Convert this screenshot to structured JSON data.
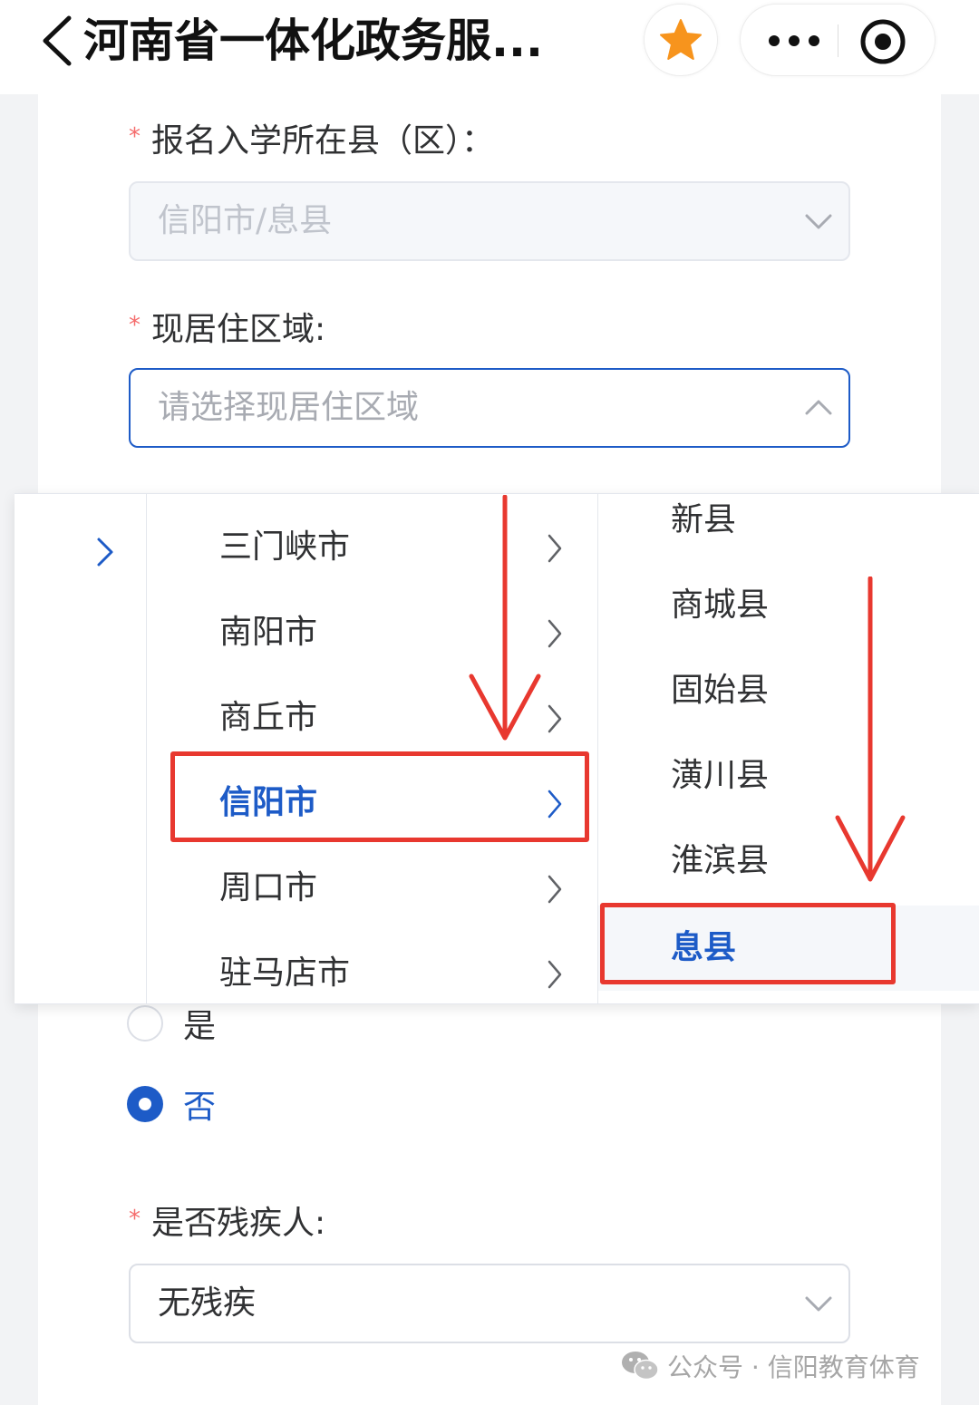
{
  "navbar": {
    "title": "河南省一体化政务服...",
    "icons": {
      "back": "chevron-left-icon",
      "favorite": "star-icon",
      "more": "more-dots-icon",
      "close": "record-circle-icon"
    },
    "star_color": "#f7941d"
  },
  "form": {
    "enroll_county": {
      "label": "报名入学所在县（区）：",
      "value": "信阳市/息县",
      "disabled": true
    },
    "residence_area": {
      "label": "现居住区域:",
      "placeholder": "请选择现居住区域",
      "open": true
    },
    "radio_group": {
      "options": [
        {
          "label": "是",
          "checked": false
        },
        {
          "label": "否",
          "checked": true
        }
      ]
    },
    "disability": {
      "label": "是否残疾人:",
      "value": "无残疾"
    },
    "required_mark": "*"
  },
  "cascader": {
    "cities": [
      {
        "label": "三门峡市",
        "selected": false
      },
      {
        "label": "南阳市",
        "selected": false
      },
      {
        "label": "商丘市",
        "selected": false
      },
      {
        "label": "信阳市",
        "selected": true
      },
      {
        "label": "周口市",
        "selected": false
      },
      {
        "label": "驻马店市",
        "selected": false
      }
    ],
    "counties": [
      {
        "label": "新县",
        "selected": false
      },
      {
        "label": "商城县",
        "selected": false
      },
      {
        "label": "固始县",
        "selected": false
      },
      {
        "label": "潢川县",
        "selected": false
      },
      {
        "label": "淮滨县",
        "selected": false
      },
      {
        "label": "息县",
        "selected": true
      }
    ]
  },
  "watermark": {
    "text": "公众号 · 信阳教育体育",
    "icon": "wechat-icon"
  },
  "colors": {
    "accent": "#1d5bc7",
    "annotation_red": "#e8382f",
    "required_red": "#f56c6c"
  }
}
